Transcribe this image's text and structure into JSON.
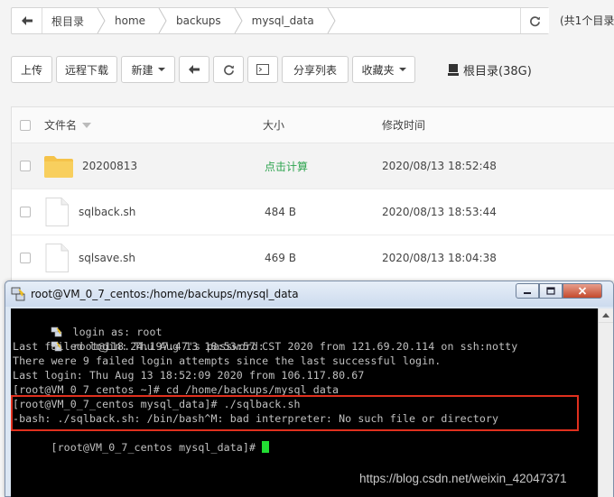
{
  "breadcrumb": {
    "items": [
      "根目录",
      "home",
      "backups",
      "mysql_data"
    ],
    "total_text": "(共1个目录"
  },
  "toolbar": {
    "upload": "上传",
    "remote_download": "远程下载",
    "new": "新建",
    "share_list": "分享列表",
    "favorites": "收藏夹",
    "disk_label": "根目录(38G)"
  },
  "table": {
    "headers": {
      "name": "文件名",
      "size": "大小",
      "modified": "修改时间"
    },
    "rows": [
      {
        "type": "folder",
        "name": "20200813",
        "size": "点击计算",
        "modified": "2020/08/13 18:52:48"
      },
      {
        "type": "file",
        "name": "sqlback.sh",
        "size": "484 B",
        "modified": "2020/08/13 18:53:44"
      },
      {
        "type": "file",
        "name": "sqlsave.sh",
        "size": "469 B",
        "modified": "2020/08/13 18:04:38"
      }
    ]
  },
  "terminal": {
    "title": "root@VM_0_7_centos:/home/backups/mysql_data",
    "lines": [
      "login as: root",
      "root@118.24.197.47's password:",
      "Last failed login: Thu Aug 13 18:53:57 CST 2020 from 121.69.20.114 on ssh:notty",
      "There were 9 failed login attempts since the last successful login.",
      "Last login: Thu Aug 13 18:52:09 2020 from 106.117.80.67",
      "[root@VM_0_7_centos ~]# cd /home/backups/mysql_data",
      "[root@VM_0_7_centos mysql_data]# ./sqlback.sh",
      "-bash: ./sqlback.sh: /bin/bash^M: bad interpreter: No such file or directory",
      "[root@VM_0_7_centos mysql_data]# "
    ]
  },
  "watermark": "https://blog.csdn.net/weixin_42047371",
  "colors": {
    "highlight_box": "#e0301e",
    "cursor": "#22dd33",
    "calc_link": "#2ea44f",
    "folder": "#f5c34a"
  }
}
